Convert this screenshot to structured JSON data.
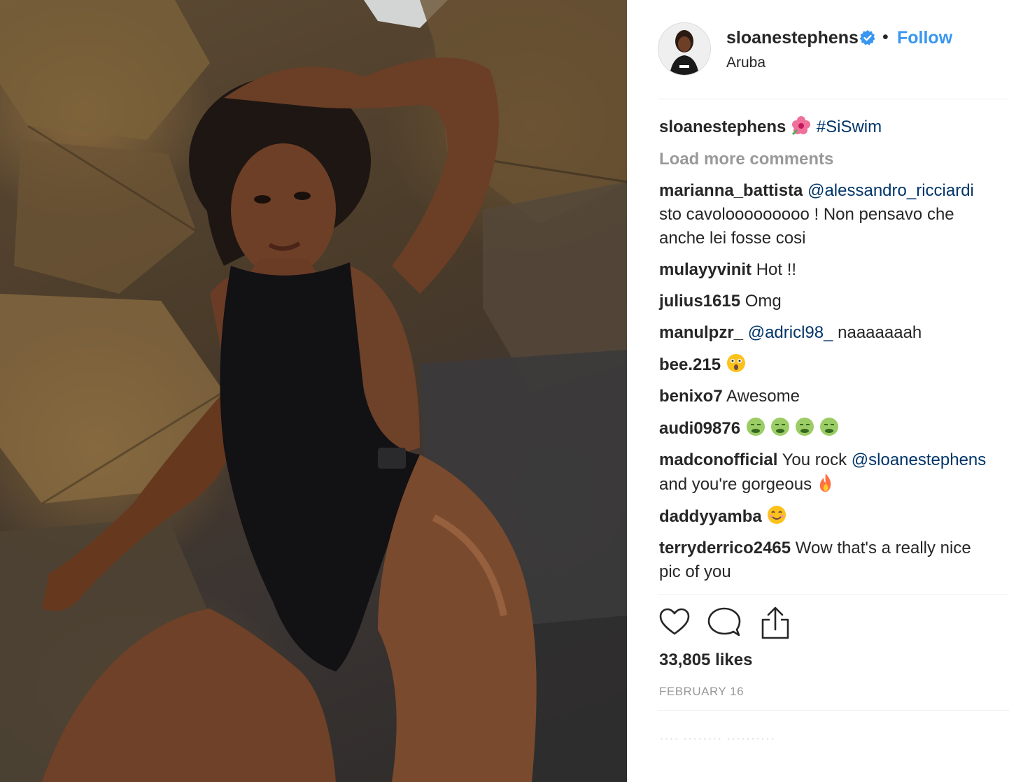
{
  "post": {
    "username": "sloanestephens",
    "follow_label": "Follow",
    "separator": "•",
    "location": "Aruba",
    "caption_hashtag": "#SiSwim",
    "load_more": "Load more comments",
    "likes": "33,805 likes",
    "date": "FEBRUARY 16",
    "faded_text": "···· ········ ··········"
  },
  "colors": {
    "link": "#3897f0",
    "mention": "#003569",
    "text": "#262626",
    "muted": "#999999",
    "verified": "#3897f0"
  },
  "comments": [
    {
      "user": "marianna_battista",
      "mention": "@alessandro_ricciardi",
      "line2": "sto cavolooooooooo ! Non pensavo che",
      "line3": "anche lei fosse cosi"
    },
    {
      "user": "mulayyvinit",
      "text": "Hot !!"
    },
    {
      "user": "julius1615",
      "text": "Omg"
    },
    {
      "user": "manulpzr_",
      "mention": "@adricl98_",
      "text": "naaaaaaah"
    },
    {
      "user": "bee.215",
      "emoji": "astonished-face-emoji"
    },
    {
      "user": "benixo7",
      "text": "Awesome"
    },
    {
      "user": "audi09876",
      "emoji": "nauseated-face-emoji x4"
    },
    {
      "user": "madconofficial",
      "text": "You rock",
      "mention": "@sloanestephens",
      "line2": "and you're gorgeous",
      "emoji": "fire-emoji"
    },
    {
      "user": "daddyyamba",
      "emoji": "smiling-face-emoji"
    },
    {
      "user": "terryderrico2465",
      "text": "Wow that's a really nice",
      "line2": "pic of you"
    }
  ],
  "icons": [
    "heart-icon",
    "comment-icon",
    "share-icon",
    "verified-badge-icon",
    "hibiscus-emoji"
  ]
}
